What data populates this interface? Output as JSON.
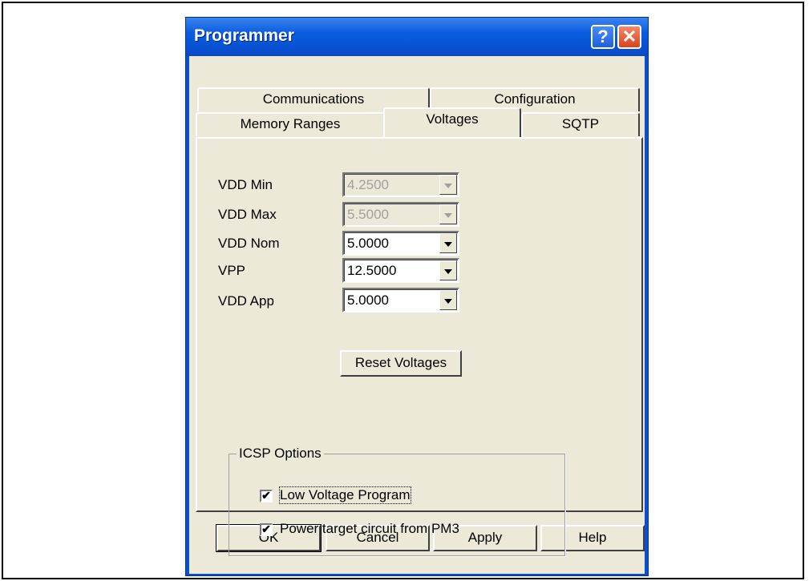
{
  "dialog": {
    "title": "Programmer",
    "help_glyph": "?",
    "close_glyph": "✕"
  },
  "tabs": {
    "back_row": [
      "Communications",
      "Configuration"
    ],
    "front_row": [
      "Memory Ranges",
      "Voltages",
      "SQTP"
    ],
    "active": "Voltages"
  },
  "voltages": {
    "vdd_min": {
      "label": "VDD Min",
      "value": "4.2500",
      "enabled": false
    },
    "vdd_max": {
      "label": "VDD Max",
      "value": "5.5000",
      "enabled": false
    },
    "vdd_nom": {
      "label": "VDD Nom",
      "value": "5.0000",
      "enabled": true
    },
    "vpp": {
      "label": "VPP",
      "value": "12.5000",
      "enabled": true
    },
    "vdd_app": {
      "label": "VDD App",
      "value": "5.0000",
      "enabled": true
    }
  },
  "reset_button": "Reset Voltages",
  "icsp": {
    "title": "ICSP Options",
    "low_voltage": {
      "label": "Low Voltage Program",
      "checked": true
    },
    "power_target": {
      "label": "Power target circuit from PM3",
      "checked": true
    },
    "check_glyph": "✔"
  },
  "buttons": {
    "ok": "OK",
    "cancel": "Cancel",
    "apply": "Apply",
    "help": "Help"
  },
  "icons": {
    "help": "help-icon",
    "close": "close-icon",
    "dropdown": "chevron-down-icon",
    "checkmark": "checkmark-icon"
  }
}
